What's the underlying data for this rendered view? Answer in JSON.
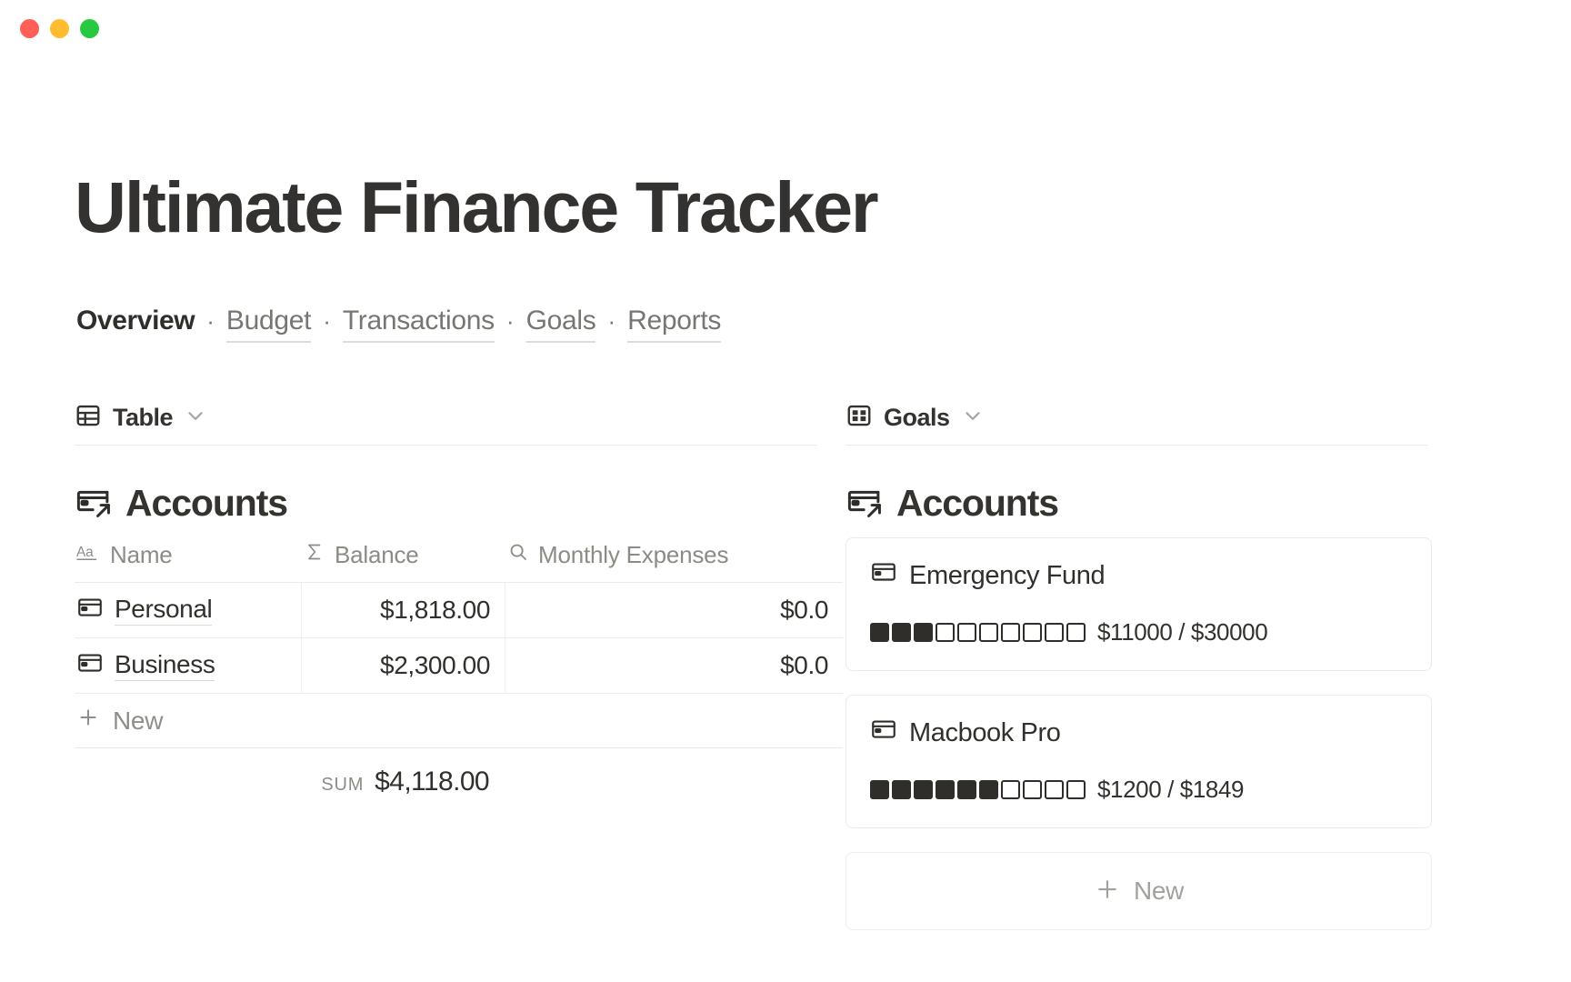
{
  "window": {
    "controls": [
      {
        "name": "close",
        "color": "#ff5f57"
      },
      {
        "name": "minimize",
        "color": "#febc2e"
      },
      {
        "name": "zoom",
        "color": "#28c840"
      }
    ]
  },
  "page": {
    "title": "Ultimate Finance Tracker"
  },
  "nav": {
    "separator": "·",
    "items": [
      {
        "label": "Overview",
        "active": true
      },
      {
        "label": "Budget",
        "active": false
      },
      {
        "label": "Transactions",
        "active": false
      },
      {
        "label": "Goals",
        "active": false
      },
      {
        "label": "Reports",
        "active": false
      }
    ]
  },
  "left": {
    "view": {
      "icon": "table-icon",
      "label": "Table",
      "chevron": "chevron-down-icon"
    },
    "database": {
      "icon": "card-link-icon",
      "title": "Accounts"
    },
    "table": {
      "columns": [
        {
          "label": "Name",
          "icon": "text-aa-icon"
        },
        {
          "label": "Balance",
          "icon": "sigma-icon"
        },
        {
          "label": "Monthly Expenses",
          "icon": "search-icon"
        }
      ],
      "rows": [
        {
          "icon": "card-icon",
          "name": "Personal",
          "balance": "$1,818.00",
          "monthly_expenses": "$0.0"
        },
        {
          "icon": "card-icon",
          "name": "Business",
          "balance": "$2,300.00",
          "monthly_expenses": "$0.0"
        }
      ],
      "new_row_label": "New",
      "sum_label": "SUM",
      "sum_value": "$4,118.00"
    }
  },
  "right": {
    "view": {
      "icon": "gallery-icon",
      "label": "Goals",
      "chevron": "chevron-down-icon"
    },
    "database": {
      "icon": "card-link-icon",
      "title": "Accounts"
    },
    "cards": [
      {
        "icon": "card-icon",
        "title": "Emergency Fund",
        "pips_total": 10,
        "pips_filled": 3,
        "progress_text": "$11000 / $30000",
        "current": 11000,
        "target": 30000
      },
      {
        "icon": "card-icon",
        "title": "Macbook Pro",
        "pips_total": 10,
        "pips_filled": 6,
        "progress_text": "$1200 / $1849",
        "current": 1200,
        "target": 1849
      }
    ],
    "new_card_label": "New"
  },
  "colors": {
    "text_primary": "#32302c",
    "text_muted": "#8d8b86",
    "border": "#eceae7",
    "background": "#ffffff"
  }
}
